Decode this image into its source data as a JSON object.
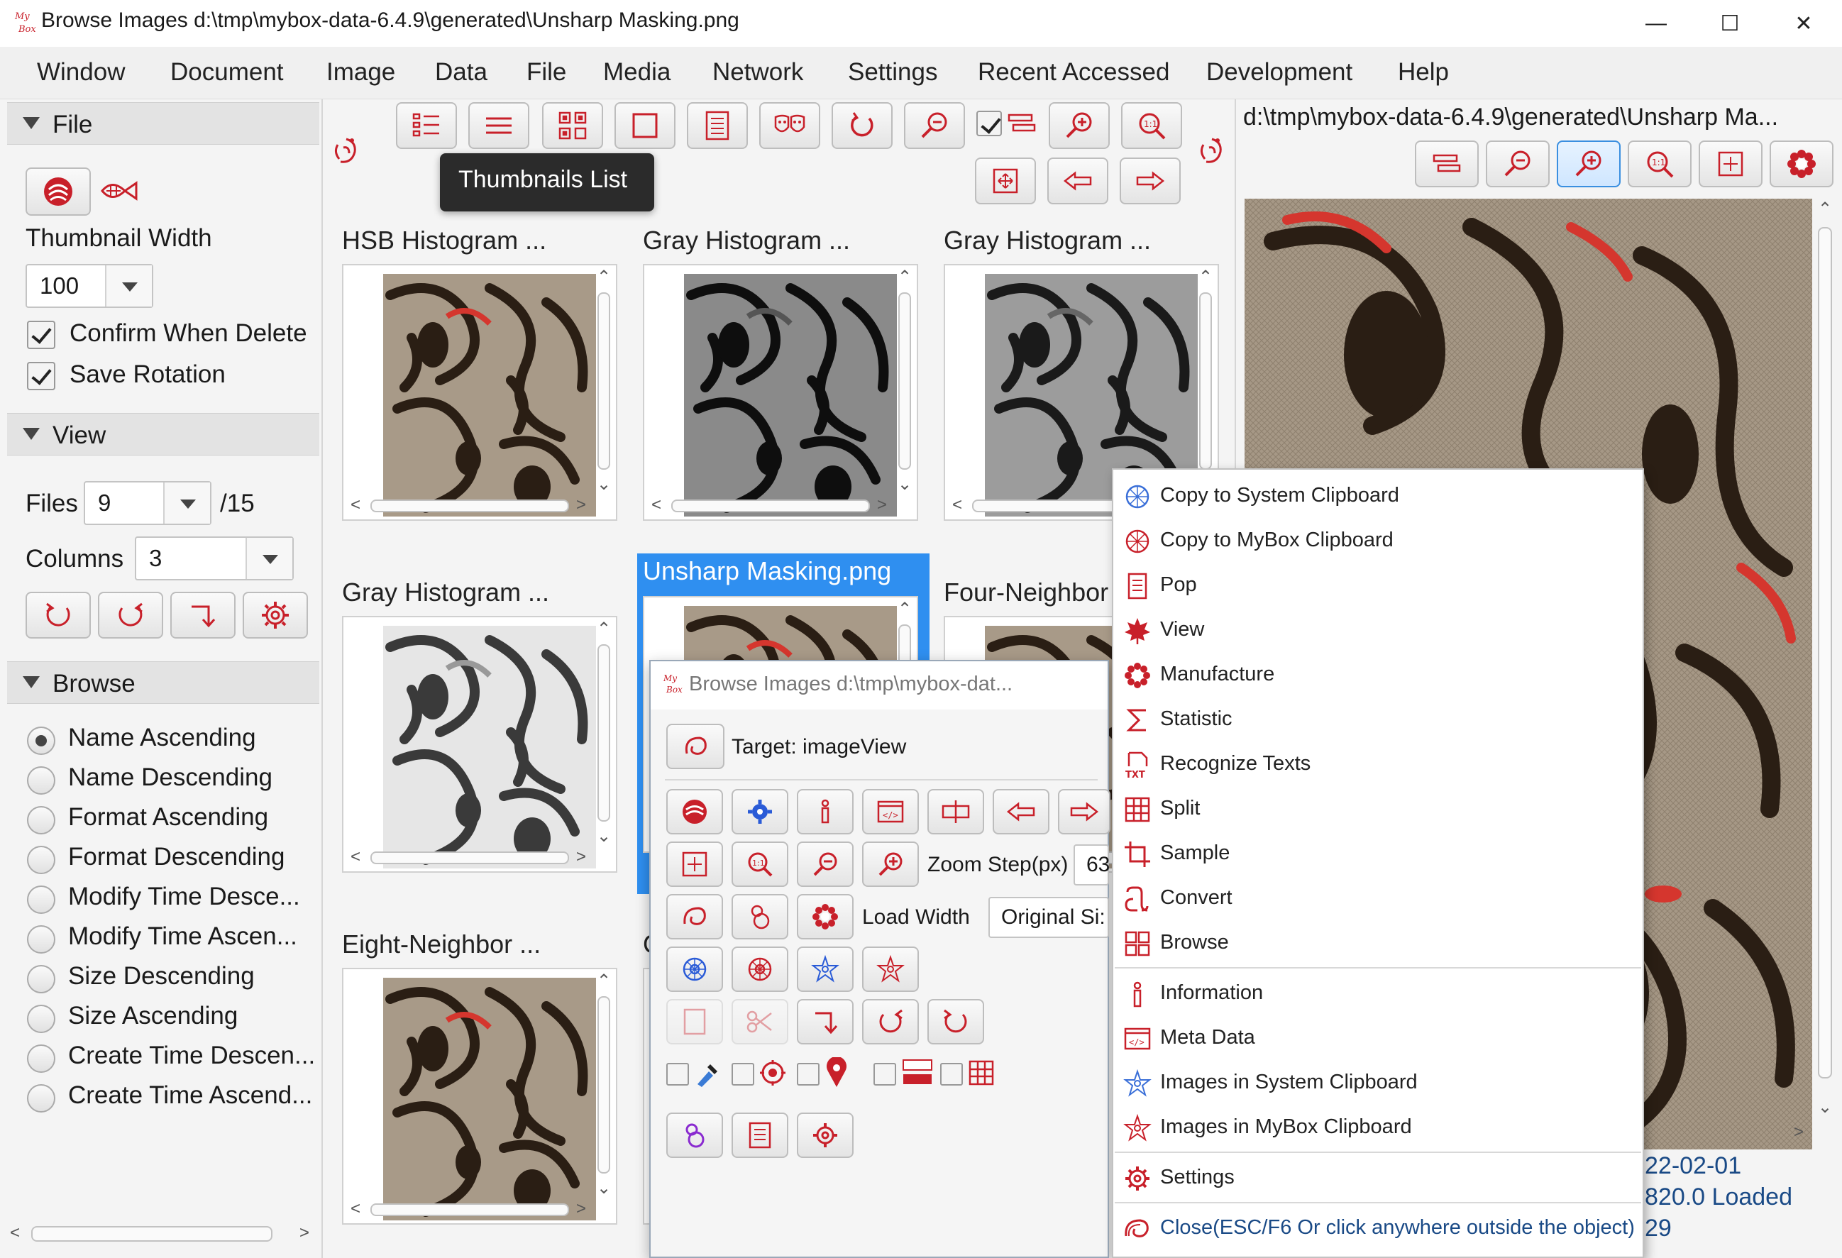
{
  "window": {
    "title": "Browse Images d:\\tmp\\mybox-data-6.4.9\\generated\\Unsharp Masking.png",
    "logo_text": "My Box",
    "minimize": "—",
    "maximize": "☐",
    "close": "✕"
  },
  "menubar": [
    "Window",
    "Document",
    "Image",
    "Data",
    "File",
    "Media",
    "Network",
    "Settings",
    "Recent Accessed",
    "Development",
    "Help"
  ],
  "left_panel": {
    "file_section": {
      "title": "File",
      "thumbnail_width_label": "Thumbnail Width",
      "thumbnail_width_value": "100",
      "confirm_delete_label": "Confirm When Delete",
      "confirm_delete_checked": true,
      "save_rotation_label": "Save Rotation",
      "save_rotation_checked": true
    },
    "view_section": {
      "title": "View",
      "files_label": "Files",
      "files_value": "9",
      "files_total": "/15",
      "columns_label": "Columns",
      "columns_value": "3"
    },
    "browse_section": {
      "title": "Browse",
      "sort_options": [
        {
          "label": "Name Ascending",
          "selected": true
        },
        {
          "label": "Name Descending",
          "selected": false
        },
        {
          "label": "Format Ascending",
          "selected": false
        },
        {
          "label": "Format Descending",
          "selected": false
        },
        {
          "label": "Modify Time Desce...",
          "selected": false
        },
        {
          "label": "Modify Time Ascen...",
          "selected": false
        },
        {
          "label": "Size Descending",
          "selected": false
        },
        {
          "label": "Size Ascending",
          "selected": false
        },
        {
          "label": "Create Time Descen...",
          "selected": false
        },
        {
          "label": "Create Time Ascend...",
          "selected": false
        }
      ]
    }
  },
  "thumbnails": {
    "tooltip": "Thumbnails List",
    "items": [
      {
        "title": "HSB Histogram ...",
        "tone": "color"
      },
      {
        "title": "Gray Histogram ...",
        "tone": "gray-dark"
      },
      {
        "title": "Gray Histogram ...",
        "tone": "gray"
      },
      {
        "title": "Gray Histogram ...",
        "tone": "gray-light"
      },
      {
        "title": "Unsharp Masking.png",
        "tone": "color",
        "selected": true
      },
      {
        "title": "Four-Neighbor",
        "tone": "color"
      },
      {
        "title": "Eight-Neighbor ...",
        "tone": "color"
      },
      {
        "title": "C",
        "tone": "color"
      }
    ]
  },
  "right_panel": {
    "path_title": "d:\\tmp\\mybox-data-6.4.9\\generated\\Unsharp Ma...",
    "status_line1": "22-02-01",
    "status_line2": "820.0  Loaded",
    "status_line3": "29"
  },
  "popup": {
    "title": "Browse Images d:\\tmp\\mybox-dat...",
    "target_label": "Target: imageView",
    "zoom_step_label": "Zoom Step(px)",
    "zoom_step_value": "63",
    "load_width_label": "Load Width",
    "load_width_value": "Original Si:"
  },
  "context_menu": {
    "items": [
      {
        "label": "Copy to System Clipboard",
        "icon": "clipboard-blue-icon"
      },
      {
        "label": "Copy to MyBox Clipboard",
        "icon": "clipboard-red-icon"
      },
      {
        "label": "Pop",
        "icon": "pop-icon"
      },
      {
        "label": "View",
        "icon": "maple-leaf-icon"
      },
      {
        "label": "Manufacture",
        "icon": "flower-icon"
      },
      {
        "label": "Statistic",
        "icon": "sigma-icon"
      },
      {
        "label": "Recognize Texts",
        "icon": "ocr-icon"
      },
      {
        "label": "Split",
        "icon": "grid-icon"
      },
      {
        "label": "Sample",
        "icon": "crop-icon"
      },
      {
        "label": "Convert",
        "icon": "convert-icon"
      },
      {
        "label": "Browse",
        "icon": "browse-grid-icon"
      },
      {
        "label": "Information",
        "icon": "info-icon"
      },
      {
        "label": "Meta Data",
        "icon": "code-icon"
      },
      {
        "label": "Images in System Clipboard",
        "icon": "star-blue-icon"
      },
      {
        "label": "Images in MyBox Clipboard",
        "icon": "star-red-icon"
      },
      {
        "label": "Settings",
        "icon": "gear-icon"
      },
      {
        "label": "Close(ESC/F6 Or click anywhere outside the object)",
        "icon": "close-swirl-icon"
      }
    ]
  },
  "colors": {
    "accent_red": "#c8202a",
    "selection_blue": "#2f8ff0",
    "link_blue": "#1a4a86"
  }
}
